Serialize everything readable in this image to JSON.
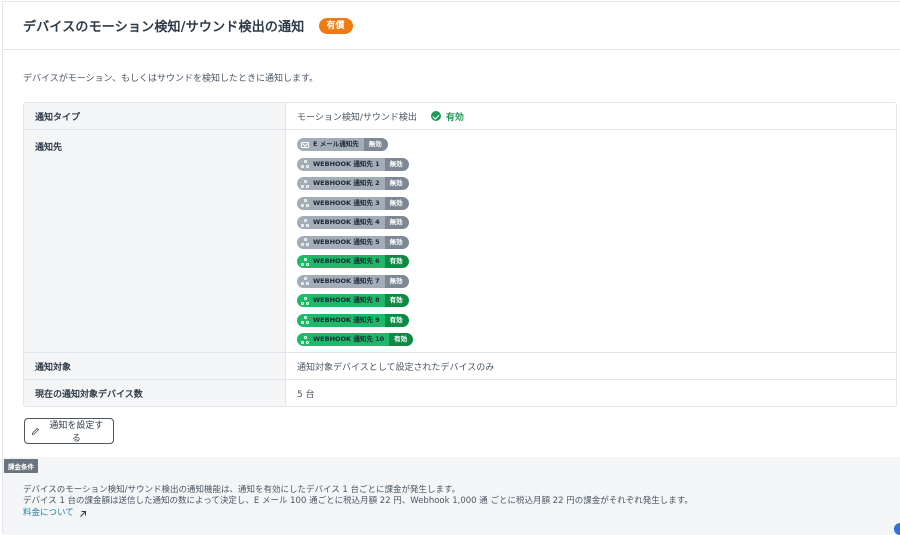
{
  "header": {
    "title": "デバイスのモーション検知/サウンド検出の通知",
    "paid_badge": "有償"
  },
  "description": "デバイスがモーション、もしくはサウンドを検知したときに通知します。",
  "table": {
    "notification_type": {
      "label": "通知タイプ",
      "value": "モーション検知/サウンド検出",
      "status": "有効"
    },
    "destinations": {
      "label": "通知先",
      "items": [
        {
          "icon": "mail-icon",
          "name": "E メール通知先",
          "state": "無効",
          "enabled": false
        },
        {
          "icon": "webhook-icon",
          "name": "WEBHOOK 通知先 1",
          "state": "無効",
          "enabled": false
        },
        {
          "icon": "webhook-icon",
          "name": "WEBHOOK 通知先 2",
          "state": "無効",
          "enabled": false
        },
        {
          "icon": "webhook-icon",
          "name": "WEBHOOK 通知先 3",
          "state": "無効",
          "enabled": false
        },
        {
          "icon": "webhook-icon",
          "name": "WEBHOOK 通知先 4",
          "state": "無効",
          "enabled": false
        },
        {
          "icon": "webhook-icon",
          "name": "WEBHOOK 通知先 5",
          "state": "無効",
          "enabled": false
        },
        {
          "icon": "webhook-icon",
          "name": "WEBHOOK 通知先 6",
          "state": "有効",
          "enabled": true
        },
        {
          "icon": "webhook-icon",
          "name": "WEBHOOK 通知先 7",
          "state": "無効",
          "enabled": false
        },
        {
          "icon": "webhook-icon",
          "name": "WEBHOOK 通知先 8",
          "state": "有効",
          "enabled": true
        },
        {
          "icon": "webhook-icon",
          "name": "WEBHOOK 通知先 9",
          "state": "有効",
          "enabled": true
        },
        {
          "icon": "webhook-icon",
          "name": "WEBHOOK 通知先 10",
          "state": "有効",
          "enabled": true
        }
      ]
    },
    "target": {
      "label": "通知対象",
      "value": "通知対象デバイスとして設定されたデバイスのみ"
    },
    "device_count": {
      "label": "現在の通知対象デバイス数",
      "value": "5 台"
    }
  },
  "edit_button": "通知を設定する",
  "billing": {
    "tag": "課金条件",
    "line1": "デバイスのモーション検知/サウンド検出の通知機能は、通知を有効にしたデバイス 1 台ごとに課金が発生します。",
    "line2": "デバイス 1 台の課金額は送信した通知の数によって決定し、E メール 100 通ごとに税込月額 22 円、Webhook 1,000 通 ごとに税込月額 22 円の課金がそれぞれ発生します。",
    "link": "料金について"
  },
  "colors": {
    "paid_badge": "#f07a12",
    "enabled_green": "#1d9b57",
    "pill_on": "#1db868",
    "pill_off": "#a3adb8",
    "link": "#1b7fa6"
  }
}
